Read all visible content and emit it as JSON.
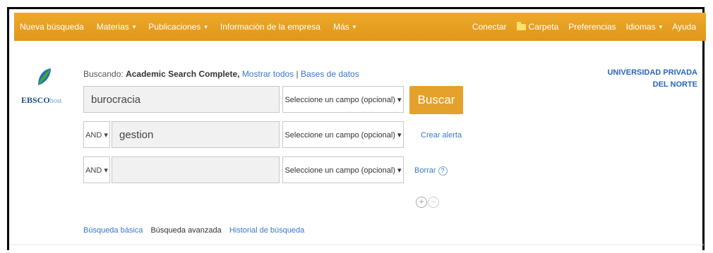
{
  "nav": {
    "left": [
      {
        "label": "Nueva búsqueda",
        "dropdown": false
      },
      {
        "label": "Materias",
        "dropdown": true
      },
      {
        "label": "Publicaciones",
        "dropdown": true
      },
      {
        "label": "Información de la empresa",
        "dropdown": false
      },
      {
        "label": "Más",
        "dropdown": true
      }
    ],
    "right": {
      "conectar": "Conectar",
      "carpeta": "Carpeta",
      "preferencias": "Preferencias",
      "idiomas": "Idiomas",
      "ayuda": "Ayuda"
    },
    "caret": "▾"
  },
  "logo": {
    "brand": "EBSCO",
    "host": "host"
  },
  "searching": {
    "prefix": "Buscando:",
    "database": "Academic Search Complete,",
    "show_all": "Mostrar todos",
    "sep": "|",
    "databases": "Bases de datos"
  },
  "rows": [
    {
      "operator": "",
      "value": "burocracia",
      "field": "Seleccione un campo (opcional) ▾"
    },
    {
      "operator": "AND ▾",
      "value": "gestion",
      "field": "Seleccione un campo (opcional) ▾"
    },
    {
      "operator": "AND ▾",
      "value": "",
      "field": "Seleccione un campo (opcional) ▾"
    }
  ],
  "buttons": {
    "buscar": "Buscar",
    "crear_alerta": "Crear alerta",
    "borrar": "Borrar",
    "help": "?",
    "add": "+",
    "remove": "−"
  },
  "university": {
    "line1": "UNIVERSIDAD PRIVADA",
    "line2": "DEL NORTE"
  },
  "bottom": {
    "basica": "Búsqueda básica",
    "avanzada": "Búsqueda avanzada",
    "historial": "Historial de búsqueda"
  },
  "colors": {
    "accent": "#e8a020",
    "link": "#3a77c9"
  }
}
